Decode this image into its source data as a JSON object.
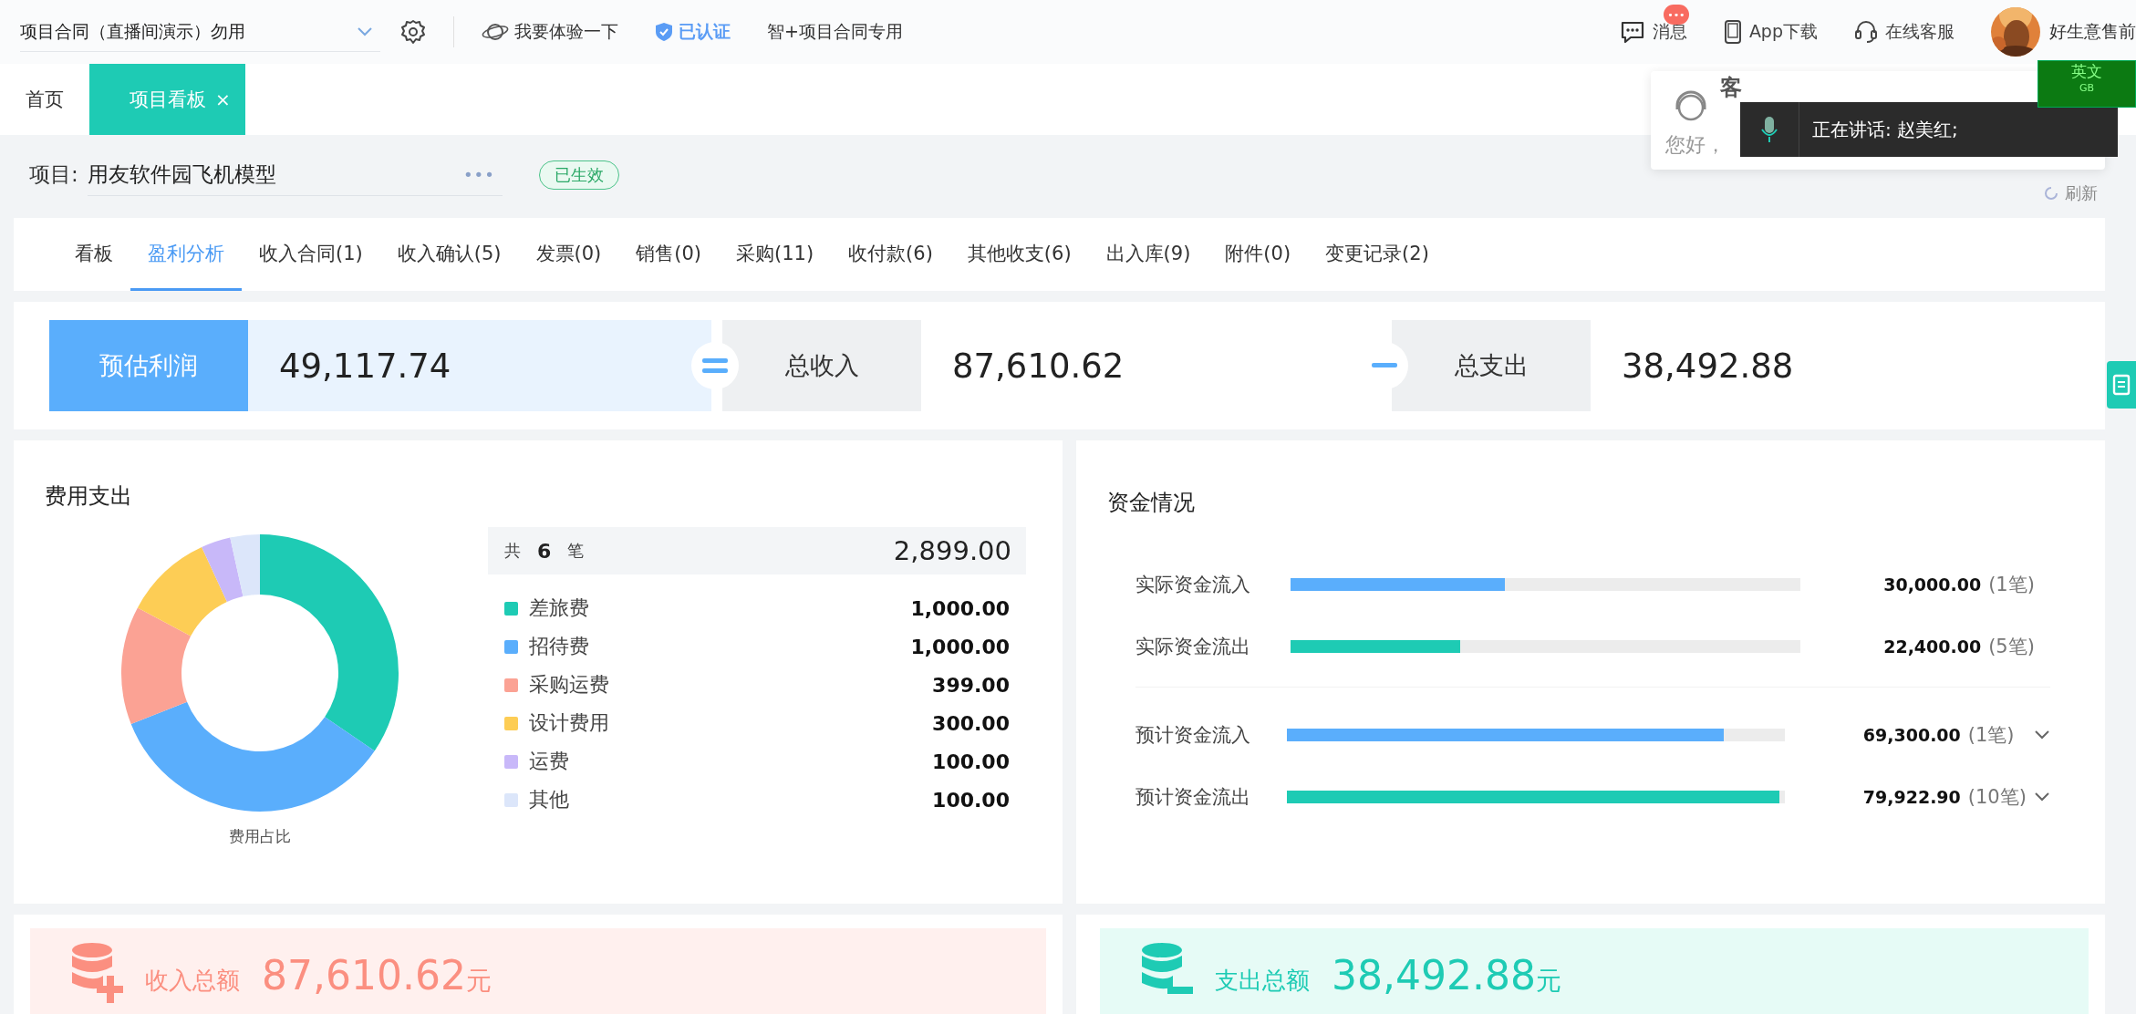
{
  "top_bar": {
    "project_select": {
      "value": "项目合同（直播间演示）勿用"
    },
    "links": [
      {
        "kind": "planet",
        "label": "我要体验一下"
      },
      {
        "kind": "verified",
        "label": "已认证"
      },
      {
        "kind": "plain",
        "label": "智+项目合同专用"
      }
    ],
    "right_items": [
      {
        "kind": "message",
        "label": "消息",
        "badge": "•••"
      },
      {
        "kind": "app",
        "label": "App下载"
      },
      {
        "kind": "service",
        "label": "在线客服"
      }
    ],
    "user": {
      "name": "好生意售前"
    }
  },
  "page_tabs": [
    {
      "label": "首页",
      "selected": false
    },
    {
      "label": "项目看板",
      "selected": true,
      "close_mark": "×"
    }
  ],
  "project": {
    "label": "项目:",
    "name": "用友软件园飞机模型",
    "more": "•••",
    "status": "已生效",
    "refresh": "刷新"
  },
  "sub_tabs": [
    {
      "label": "看板",
      "selected": false
    },
    {
      "label": "盈利分析",
      "selected": true
    },
    {
      "label": "收入合同(1)",
      "selected": false
    },
    {
      "label": "收入确认(5)",
      "selected": false
    },
    {
      "label": "发票(0)",
      "selected": false
    },
    {
      "label": "销售(0)",
      "selected": false
    },
    {
      "label": "采购(11)",
      "selected": false
    },
    {
      "label": "收付款(6)",
      "selected": false
    },
    {
      "label": "其他收支(6)",
      "selected": false
    },
    {
      "label": "出入库(9)",
      "selected": false
    },
    {
      "label": "附件(0)",
      "selected": false
    },
    {
      "label": "变更记录(2)",
      "selected": false
    }
  ],
  "summary": [
    {
      "kind": "result",
      "label": "预估利润",
      "value": "49,117.74"
    },
    {
      "kind": "equals",
      "label": "总收入",
      "value": "87,610.62"
    },
    {
      "kind": "minus",
      "label": "总支出",
      "value": "38,492.88"
    }
  ],
  "expense": {
    "title": "费用支出",
    "count_prefix": "共",
    "count": "6",
    "count_suffix": "笔",
    "total": "2,899.00",
    "chart_caption": "费用占比",
    "items": [
      {
        "name": "差旅费",
        "amount": "1,000.00",
        "color": "#1ecbb4"
      },
      {
        "name": "招待费",
        "amount": "1,000.00",
        "color": "#5aaefc"
      },
      {
        "name": "采购运费",
        "amount": "399.00",
        "color": "#fba294"
      },
      {
        "name": "设计费用",
        "amount": "300.00",
        "color": "#fdcd55"
      },
      {
        "name": "运费",
        "amount": "100.00",
        "color": "#c8b8f9"
      },
      {
        "name": "其他",
        "amount": "100.00",
        "color": "#dce6fa"
      }
    ],
    "chart_data": {
      "type": "donut",
      "values": [
        34.5,
        34.5,
        13.8,
        10.3,
        3.45,
        3.45
      ]
    }
  },
  "funds": {
    "title": "资金情况",
    "groups": [
      [
        {
          "label": "实际资金流入",
          "amount": "30,000.00",
          "count": "(1笔)",
          "level": 0.42,
          "color": "#5aaefc",
          "expandable": false
        },
        {
          "label": "实际资金流出",
          "amount": "22,400.00",
          "count": "(5笔)",
          "level": 0.333,
          "color": "#1ecbb4",
          "expandable": false
        }
      ],
      [
        {
          "label": "预计资金流入",
          "amount": "69,300.00",
          "count": "(1笔)",
          "level": 0.877,
          "color": "#5aaefc",
          "expandable": true
        },
        {
          "label": "预计资金流出",
          "amount": "79,922.90",
          "count": "(10笔)",
          "level": 0.99,
          "color": "#1ecbb4",
          "expandable": true
        }
      ]
    ]
  },
  "totals": [
    {
      "kind": "income",
      "label": "收入总额",
      "amount": "87,610.62",
      "unit": "元"
    },
    {
      "kind": "expense",
      "label": "支出总额",
      "amount": "38,492.88",
      "unit": "元"
    }
  ],
  "support_popup": {
    "title": "客",
    "greeting": "您好，"
  },
  "voice_toast": {
    "text": "正在讲话: 赵美红;"
  },
  "ime_bar": {
    "mode": "英文",
    "charset": "GB"
  }
}
